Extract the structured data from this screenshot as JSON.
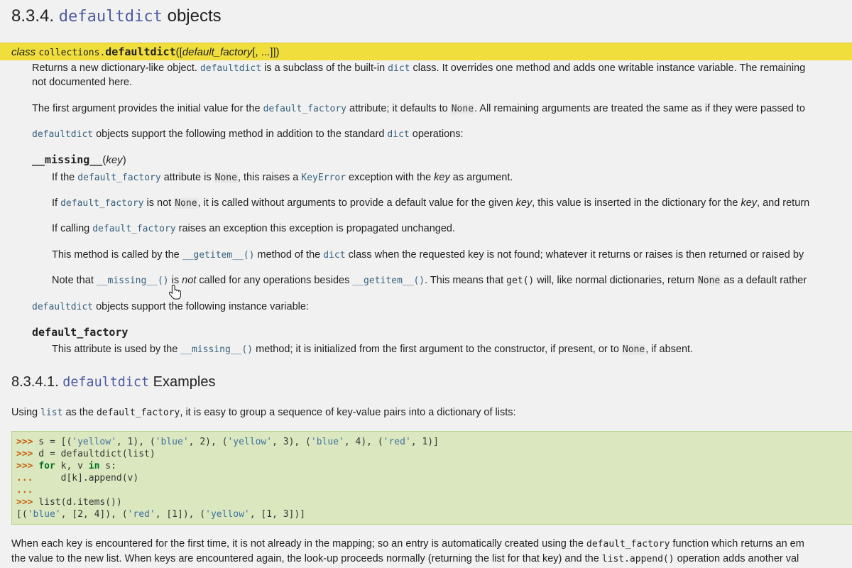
{
  "heading1": {
    "number": "8.3.4.",
    "code": "defaultdict",
    "rest": "objects"
  },
  "signature": {
    "kw": "class",
    "module": "collections.",
    "name": "defaultdict",
    "open": "([",
    "param": "default_factory",
    "rest": "[, ...]])"
  },
  "p1": {
    "a": "Returns a new dictionary-like object. ",
    "b": "defaultdict",
    "c": " is a subclass of the built-in ",
    "d": "dict",
    "e": " class. It overrides one method and adds one writable instance variable. The remaining",
    "f": "not documented here."
  },
  "p2": {
    "a": "The first argument provides the initial value for the ",
    "b": "default_factory",
    "c": " attribute; it defaults to ",
    "d": "None",
    "e": ". All remaining arguments are treated the same as if they were passed to"
  },
  "p3": {
    "a": "defaultdict",
    "b": " objects support the following method in addition to the standard ",
    "c": "dict",
    "d": " operations:"
  },
  "method": {
    "name": "__missing__",
    "open": "(",
    "param": "key",
    "close": ")"
  },
  "m1": {
    "a": "If the ",
    "b": "default_factory",
    "c": " attribute is ",
    "d": "None",
    "e": ", this raises a ",
    "f": "KeyError",
    "g": " exception with the ",
    "h": "key",
    "i": " as argument."
  },
  "m2": {
    "a": "If ",
    "b": "default_factory",
    "c": " is not ",
    "d": "None",
    "e": ", it is called without arguments to provide a default value for the given ",
    "f": "key",
    "g": ", this value is inserted in the dictionary for the ",
    "h": "key",
    "i": ", and return"
  },
  "m3": {
    "a": "If calling ",
    "b": "default_factory",
    "c": " raises an exception this exception is propagated unchanged."
  },
  "m4": {
    "a": "This method is called by the ",
    "b": "__getitem__()",
    "c": " method of the ",
    "d": "dict",
    "e": " class when the requested key is not found; whatever it returns or raises is then returned or raised by"
  },
  "m5": {
    "a": "Note that ",
    "b": "__missing__()",
    "c": " is ",
    "d": "not",
    "e": " called for any operations besides ",
    "f": "__getitem__()",
    "g": ". This means that ",
    "h": "get()",
    "i": " will, like normal dictionaries, return ",
    "j": "None",
    "k": " as a default rather"
  },
  "p4": {
    "a": "defaultdict",
    "b": " objects support the following instance variable:"
  },
  "attr": {
    "name": "default_factory"
  },
  "a1": {
    "a": "This attribute is used by the ",
    "b": "__missing__()",
    "c": " method; it is initialized from the first argument to the constructor, if present, or to ",
    "d": "None",
    "e": ", if absent."
  },
  "heading2": {
    "number": "8.3.4.1.",
    "code": "defaultdict",
    "rest": "Examples"
  },
  "p5": {
    "a": "Using ",
    "b": "list",
    "c": " as the ",
    "d": "default_factory",
    "e": ", it is easy to group a sequence of key-value pairs into a dictionary of lists:"
  },
  "code": {
    "l1": {
      "prompt": ">>>",
      "a": " s = [(",
      "s1": "'yellow'",
      "b": ", 1), (",
      "s2": "'blue'",
      "c": ", 2), (",
      "s3": "'yellow'",
      "d": ", 3), (",
      "s4": "'blue'",
      "e": ", 4), (",
      "s5": "'red'",
      "f": ", 1)]"
    },
    "l2": {
      "prompt": ">>>",
      "a": " d = defaultdict(list)"
    },
    "l3": {
      "prompt": ">>>",
      "kw1": "for",
      "a": " k, v ",
      "kw2": "in",
      "b": " s:"
    },
    "l4": {
      "prompt": "...",
      "a": "     d[k].append(v)"
    },
    "l5": {
      "prompt": "..."
    },
    "l6": {
      "prompt": ">>>",
      "a": " list(d.items())"
    },
    "l7": {
      "a": "[(",
      "s1": "'blue'",
      "b": ", [2, 4]), (",
      "s2": "'red'",
      "c": ", [1]), (",
      "s3": "'yellow'",
      "d": ", [1, 3])]"
    }
  },
  "p6": {
    "a": "When each key is encountered for the first time, it is not already in the mapping; so an entry is automatically created using the ",
    "b": "default_factory",
    "c": " function which returns an em",
    "d": "the value to the new list. When keys are encountered again, the look-up proceeds normally (returning the list for that key) and the ",
    "e": "list.append()",
    "f": " operation adds another val"
  },
  "cursor_icon": "hand-pointer-icon",
  "colors": {
    "signature_bg": "#f0de3c",
    "code_bg": "#dbe8bf",
    "xref": "#355f7c"
  }
}
